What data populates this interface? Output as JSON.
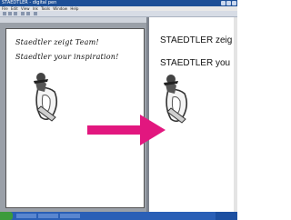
{
  "window": {
    "title": "STAEDTLER - digital pen"
  },
  "menubar": {
    "items": [
      "File",
      "Edit",
      "View",
      "Ink",
      "Tools",
      "Window",
      "Help"
    ]
  },
  "ink_page": {
    "handwritten_lines": [
      "Staedtler zeigt Team!",
      "Staedtler your inspiration!"
    ]
  },
  "text_page": {
    "lines": [
      "STAEDTLER zeig",
      "STAEDTLER you"
    ]
  },
  "colors": {
    "accent_arrow": "#e2177f",
    "title_bar": "#1d4f97",
    "taskbar": "#2a5fb6"
  },
  "icons": {
    "logo": "staedtler-mars-logo-icon",
    "arrow": "arrow-right-icon"
  }
}
